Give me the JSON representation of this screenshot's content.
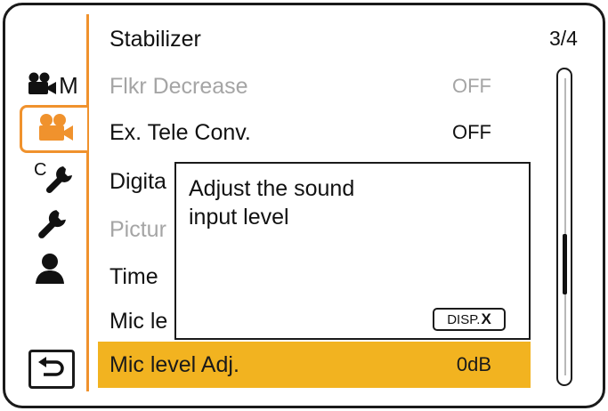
{
  "tabs": [
    {
      "id": "movie-manual",
      "icon": "movie-camera-icon",
      "letter": "M",
      "active": false
    },
    {
      "id": "movie",
      "icon": "movie-camera-icon",
      "active": true
    },
    {
      "id": "custom",
      "icon": "wrench-icon",
      "letter": "C",
      "active": false
    },
    {
      "id": "setup",
      "icon": "wrench-icon",
      "active": false
    },
    {
      "id": "my-menu",
      "icon": "person-icon",
      "active": false
    }
  ],
  "back_icon": "return-arrow-icon",
  "menu": {
    "items": [
      {
        "label": "Stabilizer",
        "value": "",
        "state": "normal"
      },
      {
        "label": "Flkr Decrease",
        "value": "OFF",
        "state": "disabled"
      },
      {
        "label": "Ex. Tele Conv.",
        "value": "OFF",
        "state": "normal"
      },
      {
        "label": "Digita",
        "value": "",
        "state": "normal"
      },
      {
        "label": "Pictur",
        "value": "",
        "state": "disabled"
      },
      {
        "label": "Time",
        "value": "",
        "state": "normal"
      },
      {
        "label": "Mic le",
        "value": "",
        "state": "normal"
      },
      {
        "label": "Mic level Adj.",
        "value": "0dB",
        "state": "selected"
      }
    ]
  },
  "page_indicator": "3/4",
  "scroll": {
    "page": 3,
    "pages": 4
  },
  "help": {
    "text_line1": "Adjust the sound",
    "text_line2": "input level",
    "close_label": "DISP.",
    "close_symbol": "X"
  },
  "colors": {
    "accent": "#f0922d",
    "selected_row": "#f2b320",
    "disabled_text": "#a5a5a5"
  }
}
